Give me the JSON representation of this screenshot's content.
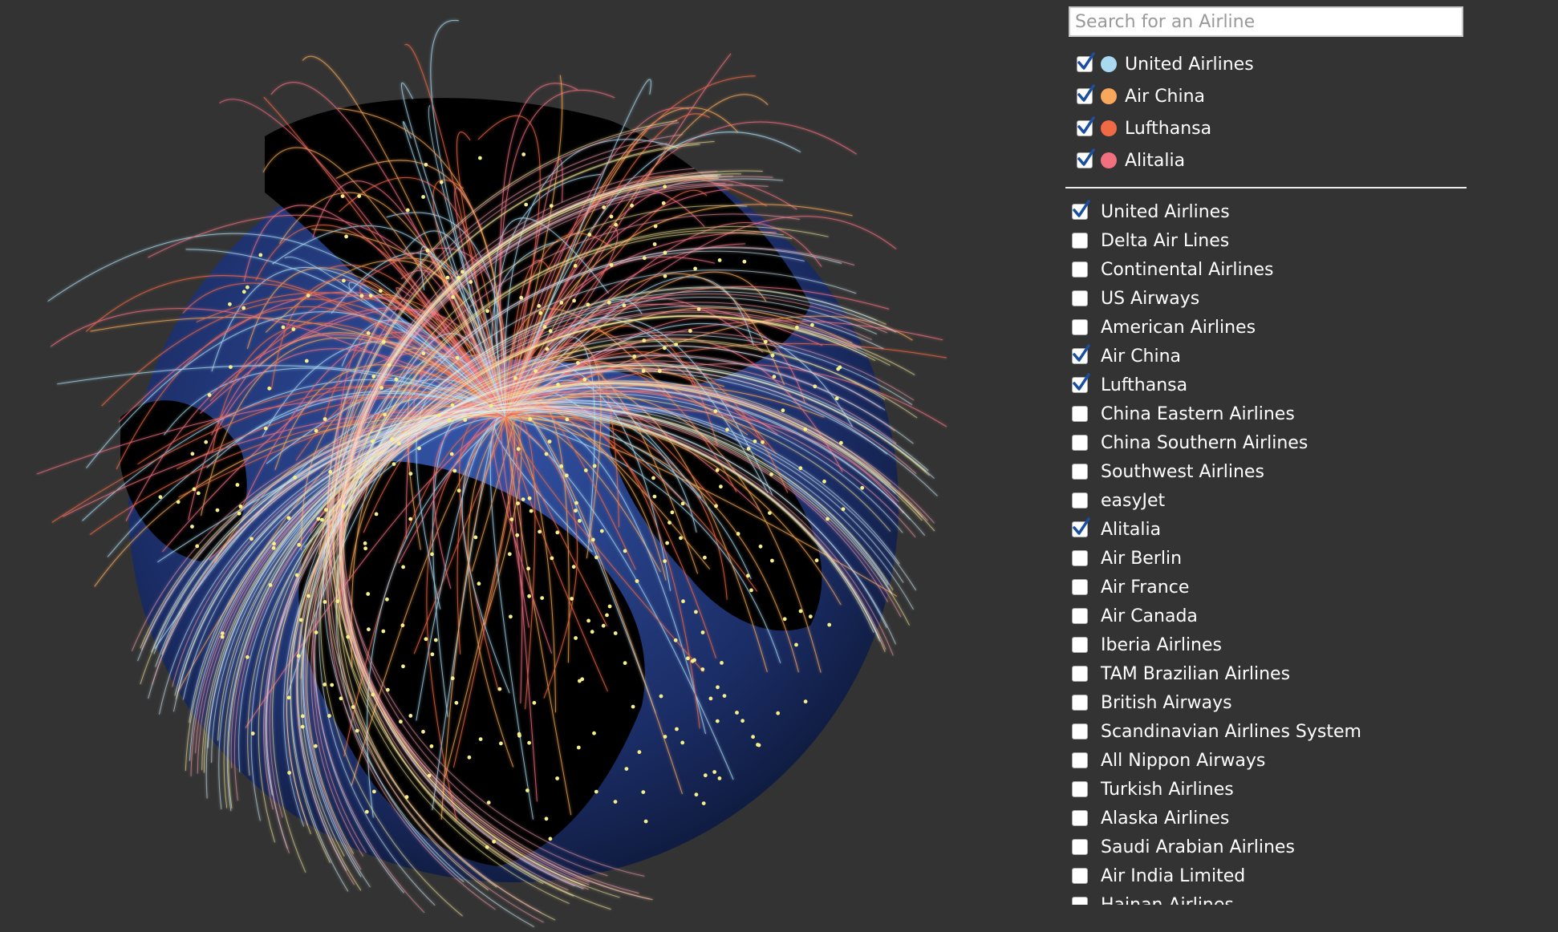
{
  "search": {
    "placeholder": "Search for an Airline",
    "value": ""
  },
  "selected_airlines": [
    {
      "label": "United Airlines",
      "color": "#a9d9f0",
      "checked": true
    },
    {
      "label": "Air China",
      "color": "#f8a85a",
      "checked": true
    },
    {
      "label": "Lufthansa",
      "color": "#f06a45",
      "checked": true
    },
    {
      "label": "Alitalia",
      "color": "#f07080",
      "checked": true
    }
  ],
  "airlines": [
    {
      "label": "United Airlines",
      "checked": true
    },
    {
      "label": "Delta Air Lines",
      "checked": false
    },
    {
      "label": "Continental Airlines",
      "checked": false
    },
    {
      "label": "US Airways",
      "checked": false
    },
    {
      "label": "American Airlines",
      "checked": false
    },
    {
      "label": "Air China",
      "checked": true
    },
    {
      "label": "Lufthansa",
      "checked": true
    },
    {
      "label": "China Eastern Airlines",
      "checked": false
    },
    {
      "label": "China Southern Airlines",
      "checked": false
    },
    {
      "label": "Southwest Airlines",
      "checked": false
    },
    {
      "label": "easyJet",
      "checked": false
    },
    {
      "label": "Alitalia",
      "checked": true
    },
    {
      "label": "Air Berlin",
      "checked": false
    },
    {
      "label": "Air France",
      "checked": false
    },
    {
      "label": "Air Canada",
      "checked": false
    },
    {
      "label": "Iberia Airlines",
      "checked": false
    },
    {
      "label": "TAM Brazilian Airlines",
      "checked": false
    },
    {
      "label": "British Airways",
      "checked": false
    },
    {
      "label": "Scandinavian Airlines System",
      "checked": false
    },
    {
      "label": "All Nippon Airways",
      "checked": false
    },
    {
      "label": "Turkish Airlines",
      "checked": false
    },
    {
      "label": "Alaska Airlines",
      "checked": false
    },
    {
      "label": "Saudi Arabian Airlines",
      "checked": false
    },
    {
      "label": "Air India Limited",
      "checked": false
    },
    {
      "label": "Hainan Airlines",
      "checked": false
    }
  ],
  "colors": {
    "background": "#333333",
    "ocean": "#1b2d66",
    "land": "#000000",
    "airport_dot": "#f6ef8a",
    "checkmark": "#1a4fa0"
  },
  "icons": {
    "checkbox_checked": "checkmark-icon",
    "legend_dot": "color-dot-icon"
  }
}
